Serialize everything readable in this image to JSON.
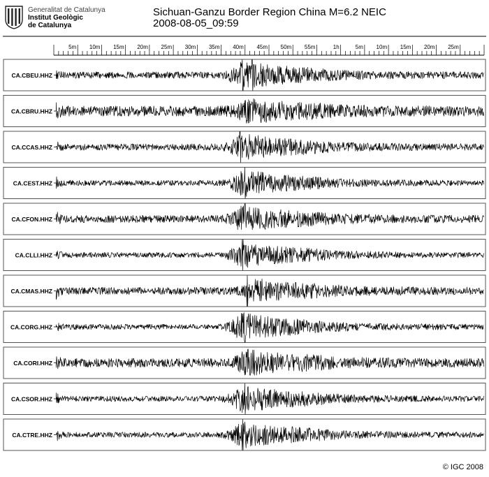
{
  "header": {
    "institution_lines": [
      "Generalitat de Catalunya",
      "Institut Geològic",
      "de Catalunya"
    ],
    "title": "Sichuan-Ganzu Border Region China M=6.2 NEIC",
    "datetime": "2008-08-05_09:59"
  },
  "footer": {
    "copyright": "© IGC 2008"
  },
  "colors": {
    "trace": "#000000",
    "panel_border": "#555555",
    "logo": "#222222"
  },
  "chart_data": {
    "type": "line",
    "title": "Sichuan-Ganzu Border Region China M=6.2 NEIC",
    "time_axis": {
      "unit": "minutes",
      "range": [
        0,
        90
      ],
      "tick_labels": [
        "5m",
        "10m",
        "15m",
        "20m",
        "25m",
        "30m",
        "35m",
        "40m",
        "45m",
        "50m",
        "55m",
        "1h",
        "5m",
        "10m",
        "15m",
        "20m",
        "25m"
      ],
      "tick_values": [
        5,
        10,
        15,
        20,
        25,
        30,
        35,
        40,
        45,
        50,
        55,
        60,
        65,
        70,
        75,
        80,
        85
      ],
      "minor_tick_step": 1,
      "position": "top"
    },
    "grid": false,
    "legend": "none",
    "series": [
      {
        "name": "CA.CBEU.HHZ",
        "p_arrival_min": 0.5,
        "burst_center_min": 40,
        "noise": 0.22,
        "peak": 1.0,
        "pulse_min": [
          39.5,
          41.5
        ]
      },
      {
        "name": "CA.CBRU.HHZ",
        "p_arrival_min": 0.5,
        "burst_center_min": 41,
        "noise": 0.35,
        "peak": 0.95,
        "pulse_min": []
      },
      {
        "name": "CA.CCAS.HHZ",
        "p_arrival_min": 0.5,
        "burst_center_min": 40,
        "noise": 0.22,
        "peak": 0.95,
        "pulse_min": [
          39
        ]
      },
      {
        "name": "CA.CEST.HHZ",
        "p_arrival_min": 0.5,
        "burst_center_min": 40,
        "noise": 0.18,
        "peak": 0.95,
        "pulse_min": [
          40
        ]
      },
      {
        "name": "CA.CFON.HHZ",
        "p_arrival_min": 0.5,
        "burst_center_min": 40,
        "noise": 0.25,
        "peak": 0.95,
        "pulse_min": [
          40
        ]
      },
      {
        "name": "CA.CLLI.HHZ",
        "p_arrival_min": 0.5,
        "burst_center_min": 40,
        "noise": 0.18,
        "peak": 0.9,
        "pulse_min": [
          39.5
        ]
      },
      {
        "name": "CA.CMAS.HHZ",
        "p_arrival_min": 0.5,
        "burst_center_min": 43,
        "noise": 0.25,
        "peak": 0.85,
        "pulse_min": [
          40.5
        ]
      },
      {
        "name": "CA.CORG.HHZ",
        "p_arrival_min": 0.5,
        "burst_center_min": 40,
        "noise": 0.18,
        "peak": 1.0,
        "pulse_min": [
          40
        ]
      },
      {
        "name": "CA.CORI.HHZ",
        "p_arrival_min": 0.5,
        "burst_center_min": 41,
        "noise": 0.3,
        "peak": 0.95,
        "pulse_min": []
      },
      {
        "name": "CA.CSOR.HHZ",
        "p_arrival_min": 0.5,
        "burst_center_min": 40,
        "noise": 0.18,
        "peak": 1.0,
        "pulse_min": [
          40
        ]
      },
      {
        "name": "CA.CTRE.HHZ",
        "p_arrival_min": 0.5,
        "burst_center_min": 40,
        "noise": 0.18,
        "peak": 0.95,
        "pulse_min": [
          39.5
        ]
      }
    ]
  }
}
